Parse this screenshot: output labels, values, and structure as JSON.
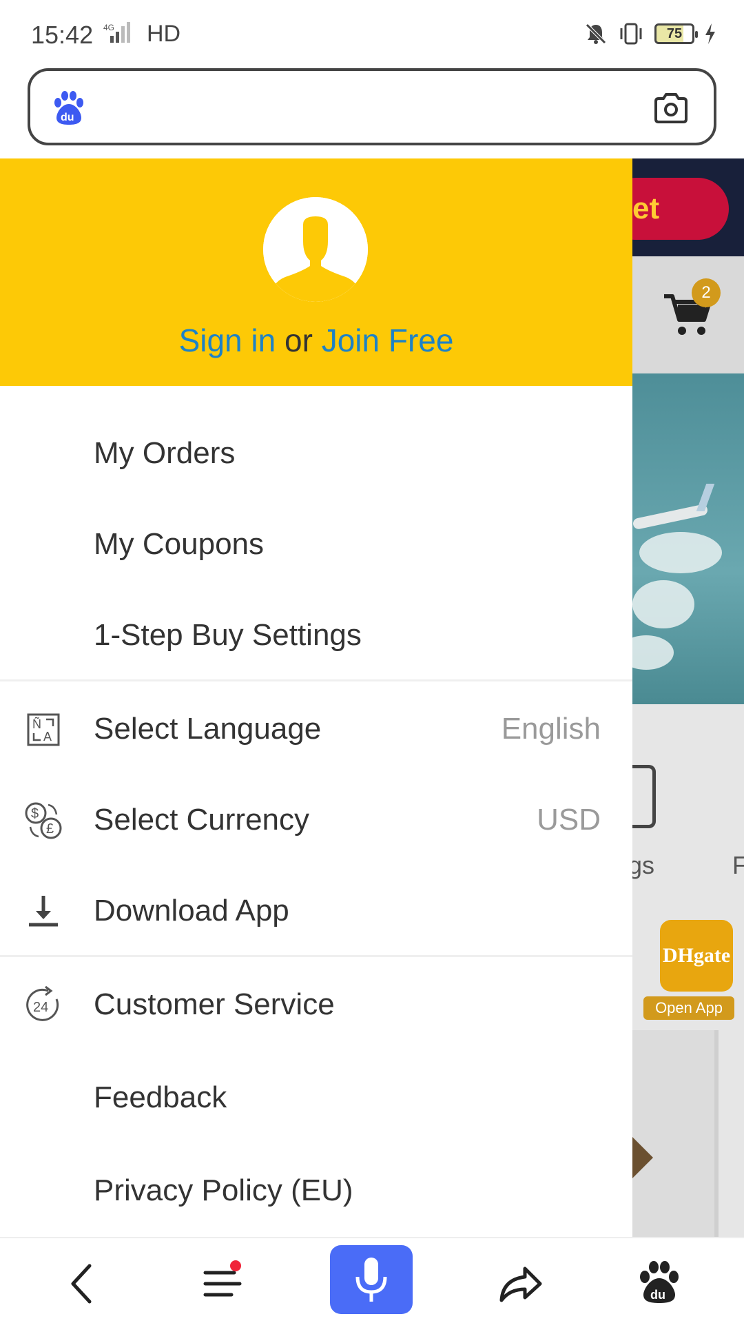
{
  "status_bar": {
    "time": "15:42",
    "network": "4G",
    "hd": "HD",
    "battery": "75"
  },
  "search": {
    "logo_icon": "baidu-paw-icon",
    "camera_icon": "camera-icon",
    "placeholder": ""
  },
  "drawer": {
    "header": {
      "sign_in": "Sign in",
      "or": "or",
      "join_free": "Join Free"
    },
    "items": [
      {
        "label": "My Orders",
        "icon": ""
      },
      {
        "label": "My Coupons",
        "icon": ""
      },
      {
        "label": "1-Step Buy Settings",
        "icon": ""
      },
      {
        "label": "Select Language",
        "value": "English",
        "icon": "translate-icon"
      },
      {
        "label": "Select Currency",
        "value": "USD",
        "icon": "currency-exchange-icon"
      },
      {
        "label": "Download App",
        "icon": "download-icon"
      },
      {
        "label": "Customer Service",
        "icon": "24h-service-icon"
      },
      {
        "label": "Feedback",
        "icon": ""
      },
      {
        "label": "Privacy Policy (EU)",
        "icon": ""
      }
    ]
  },
  "background_page": {
    "banner_text": "et",
    "cart_count": "2",
    "partial_label_1": "gs",
    "partial_label_2": "F",
    "dhgate_logo": "DHgate",
    "open_app": "Open App"
  },
  "bottom_nav": {
    "items": [
      "back-icon",
      "menu-icon",
      "microphone-icon",
      "share-icon",
      "baidu-paw-icon"
    ]
  },
  "colors": {
    "header_yellow": "#fdc906",
    "link_blue": "#1d82c6",
    "mic_blue": "#4a6cf7",
    "accent_gold": "#d29a1c"
  }
}
